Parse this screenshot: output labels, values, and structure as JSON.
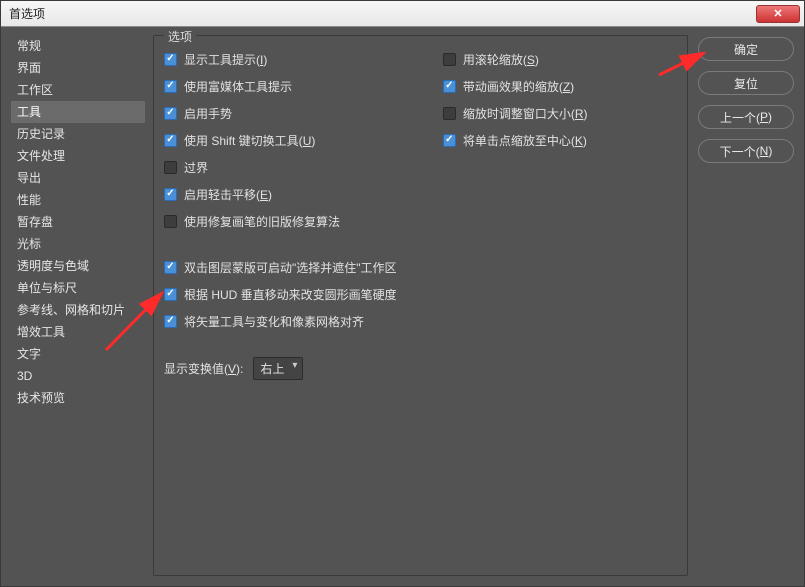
{
  "window": {
    "title": "首选项"
  },
  "sidebar": {
    "items": [
      {
        "label": "常规"
      },
      {
        "label": "界面"
      },
      {
        "label": "工作区"
      },
      {
        "label": "工具"
      },
      {
        "label": "历史记录"
      },
      {
        "label": "文件处理"
      },
      {
        "label": "导出"
      },
      {
        "label": "性能"
      },
      {
        "label": "暂存盘"
      },
      {
        "label": "光标"
      },
      {
        "label": "透明度与色域"
      },
      {
        "label": "单位与标尺"
      },
      {
        "label": "参考线、网格和切片"
      },
      {
        "label": "增效工具"
      },
      {
        "label": "文字"
      },
      {
        "label": "3D"
      },
      {
        "label": "技术预览"
      }
    ],
    "selected_index": 3
  },
  "options": {
    "legend": "选项",
    "left": [
      {
        "checked": true,
        "label": "显示工具提示(",
        "u": "I",
        "tail": ")"
      },
      {
        "checked": true,
        "label": "使用富媒体工具提示"
      },
      {
        "checked": true,
        "label": "启用手势"
      },
      {
        "checked": true,
        "label": "使用 Shift 键切换工具(",
        "u": "U",
        "tail": ")"
      },
      {
        "checked": false,
        "label": "过界"
      },
      {
        "checked": true,
        "label": "启用轻击平移(",
        "u": "E",
        "tail": ")"
      },
      {
        "checked": false,
        "label": "使用修复画笔的旧版修复算法"
      },
      {
        "checked": true,
        "label": "双击图层蒙版可启动\"选择并遮住\"工作区"
      },
      {
        "checked": true,
        "label": "根据 HUD 垂直移动来改变圆形画笔硬度"
      },
      {
        "checked": true,
        "label": "将矢量工具与变化和像素网格对齐"
      }
    ],
    "right": [
      {
        "checked": false,
        "label": "用滚轮缩放(",
        "u": "S",
        "tail": ")"
      },
      {
        "checked": true,
        "label": "带动画效果的缩放(",
        "u": "Z",
        "tail": ")"
      },
      {
        "checked": false,
        "label": "缩放时调整窗口大小(",
        "u": "R",
        "tail": ")"
      },
      {
        "checked": true,
        "label": "将单击点缩放至中心(",
        "u": "K",
        "tail": ")"
      }
    ],
    "transform": {
      "label": "显示变换值(",
      "u": "V",
      "tail": "):",
      "value": "右上"
    }
  },
  "buttons": {
    "ok": "确定",
    "reset": "复位",
    "prev_pre": "上一个(",
    "prev_u": "P",
    "prev_tail": ")",
    "next_pre": "下一个(",
    "next_u": "N",
    "next_tail": ")"
  }
}
